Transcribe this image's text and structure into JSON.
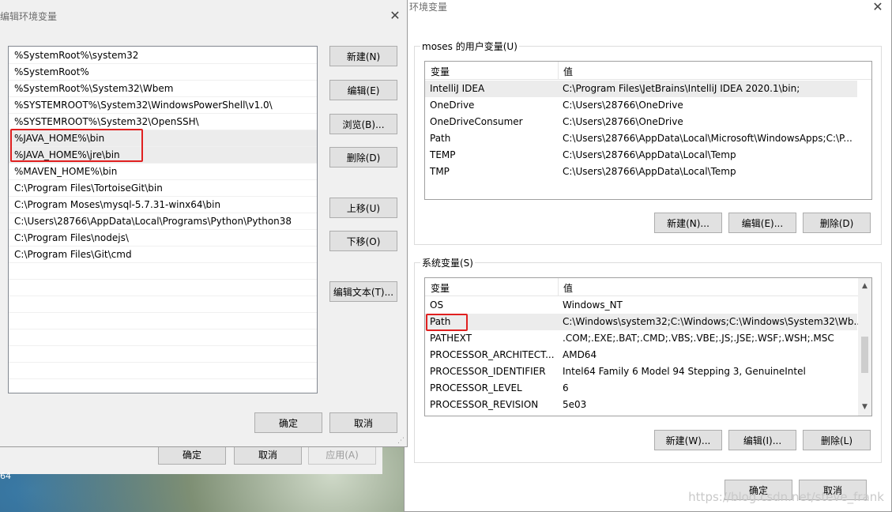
{
  "env_dialog": {
    "title": "环境变量",
    "user_group_label": "moses 的用户变量(U)",
    "columns": [
      "变量",
      "值"
    ],
    "user_vars": [
      {
        "name": "IntelliJ IDEA",
        "value": "C:\\Program Files\\JetBrains\\IntelliJ IDEA 2020.1\\bin;"
      },
      {
        "name": "OneDrive",
        "value": "C:\\Users\\28766\\OneDrive"
      },
      {
        "name": "OneDriveConsumer",
        "value": "C:\\Users\\28766\\OneDrive"
      },
      {
        "name": "Path",
        "value": "C:\\Users\\28766\\AppData\\Local\\Microsoft\\WindowsApps;C:\\P..."
      },
      {
        "name": "TEMP",
        "value": "C:\\Users\\28766\\AppData\\Local\\Temp"
      },
      {
        "name": "TMP",
        "value": "C:\\Users\\28766\\AppData\\Local\\Temp"
      }
    ],
    "user_buttons": {
      "new": "新建(N)...",
      "edit": "编辑(E)...",
      "delete": "删除(D)"
    },
    "system_group_label": "系统变量(S)",
    "system_vars": [
      {
        "name": "OS",
        "value": "Windows_NT"
      },
      {
        "name": "Path",
        "value": "C:\\Windows\\system32;C:\\Windows;C:\\Windows\\System32\\Wb..."
      },
      {
        "name": "PATHEXT",
        "value": ".COM;.EXE;.BAT;.CMD;.VBS;.VBE;.JS;.JSE;.WSF;.WSH;.MSC"
      },
      {
        "name": "PROCESSOR_ARCHITECT...",
        "value": "AMD64"
      },
      {
        "name": "PROCESSOR_IDENTIFIER",
        "value": "Intel64 Family 6 Model 94 Stepping 3, GenuineIntel"
      },
      {
        "name": "PROCESSOR_LEVEL",
        "value": "6"
      },
      {
        "name": "PROCESSOR_REVISION",
        "value": "5e03"
      }
    ],
    "system_buttons": {
      "new": "新建(W)...",
      "edit": "编辑(I)...",
      "delete": "删除(L)"
    },
    "ok": "确定",
    "cancel": "取消"
  },
  "back_dialog": {
    "ok": "确定",
    "cancel": "取消",
    "apply": "应用(A)",
    "left_edge_text": "64"
  },
  "edit_dialog": {
    "title": "编辑环境变量",
    "paths": [
      "%SystemRoot%\\system32",
      "%SystemRoot%",
      "%SystemRoot%\\System32\\Wbem",
      "%SYSTEMROOT%\\System32\\WindowsPowerShell\\v1.0\\",
      "%SYSTEMROOT%\\System32\\OpenSSH\\",
      "%JAVA_HOME%\\bin",
      "%JAVA_HOME%\\jre\\bin",
      "%MAVEN_HOME%\\bin",
      "C:\\Program Files\\TortoiseGit\\bin",
      "C:\\Program Moses\\mysql-5.7.31-winx64\\bin",
      "C:\\Users\\28766\\AppData\\Local\\Programs\\Python\\Python38",
      "C:\\Program Files\\nodejs\\",
      "C:\\Program Files\\Git\\cmd"
    ],
    "buttons": {
      "new": "新建(N)",
      "edit": "编辑(E)",
      "browse": "浏览(B)...",
      "delete": "删除(D)",
      "move_up": "上移(U)",
      "move_down": "下移(O)",
      "edit_text": "编辑文本(T)..."
    },
    "ok": "确定",
    "cancel": "取消"
  },
  "watermark": "https://blog.csdn.net/steve_frank",
  "colors": {
    "highlight_box": "#e02020",
    "selected_row": "#ececec",
    "button_bg": "#e1e1e1"
  }
}
